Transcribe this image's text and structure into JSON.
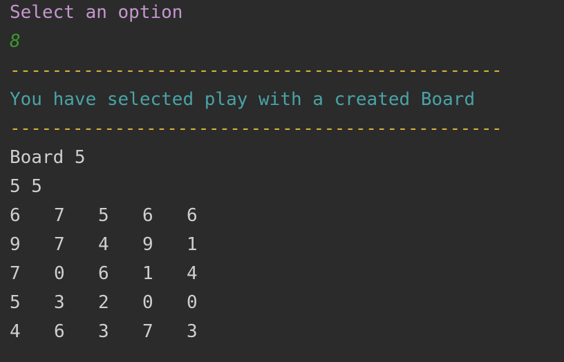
{
  "console": {
    "prompt": "Select an option",
    "input": "8",
    "separator": "-----------------------------------------------",
    "message": "You have selected play with a created Board",
    "board_title": "Board 5",
    "dimensions": "5 5",
    "rows": [
      [
        "6",
        "7",
        "5",
        "6",
        "6"
      ],
      [
        "9",
        "7",
        "4",
        "9",
        "1"
      ],
      [
        "7",
        "0",
        "6",
        "1",
        "4"
      ],
      [
        "5",
        "3",
        "2",
        "0",
        "0"
      ],
      [
        "4",
        "6",
        "3",
        "7",
        "3"
      ]
    ]
  },
  "colors": {
    "background": "#2b2b2b",
    "prompt": "#c596ce",
    "input": "#3a9a2c",
    "separator": "#d6b43a",
    "message": "#4aa3a6",
    "text": "#cfcfcf"
  }
}
